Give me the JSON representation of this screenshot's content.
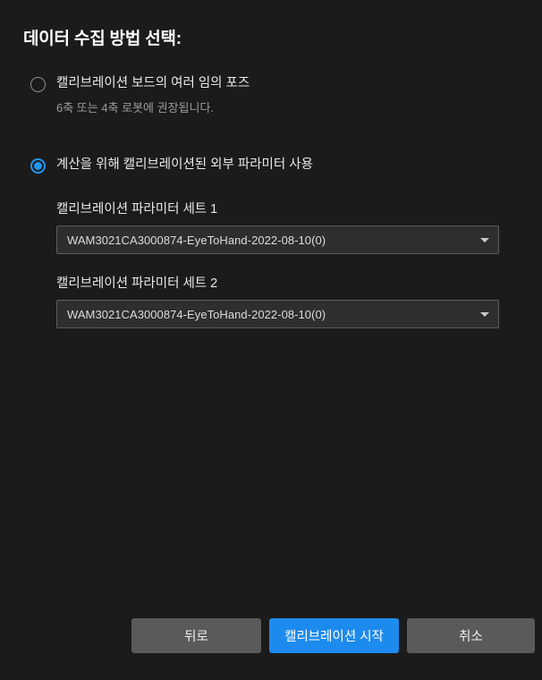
{
  "dialog": {
    "title": "데이터 수집 방법 선택:"
  },
  "options": [
    {
      "id": "random-poses",
      "label": "캘리브레이션 보드의 여러 임의 포즈",
      "help": "6축 또는 4축 로봇에 권장됩니다.",
      "selected": false
    },
    {
      "id": "use-calibrated-extrinsics",
      "label": "계산을 위해 캘리브레이션된 외부 파라미터 사용",
      "help": "",
      "selected": true
    }
  ],
  "fields": [
    {
      "id": "param-set-1",
      "label": "캘리브레이션 파라미터 세트 1",
      "value": "WAM3021CA3000874-EyeToHand-2022-08-10(0)"
    },
    {
      "id": "param-set-2",
      "label": "캘리브레이션 파라미터 세트 2",
      "value": "WAM3021CA3000874-EyeToHand-2022-08-10(0)"
    }
  ],
  "footer": {
    "back_label": "뒤로",
    "start_label": "캘리브레이션 시작",
    "cancel_label": "취소"
  },
  "colors": {
    "background": "#1b1b1b",
    "accent": "#1d8bee",
    "radio_selected": "#2196f3",
    "button_neutral": "#5a5a5a",
    "field_background": "#2e2e2e",
    "field_border": "#5c5c5c",
    "text_primary": "#e8e8e8",
    "text_muted": "#9a9a9a"
  },
  "icons": {
    "dropdown": "chevron-down-icon"
  }
}
